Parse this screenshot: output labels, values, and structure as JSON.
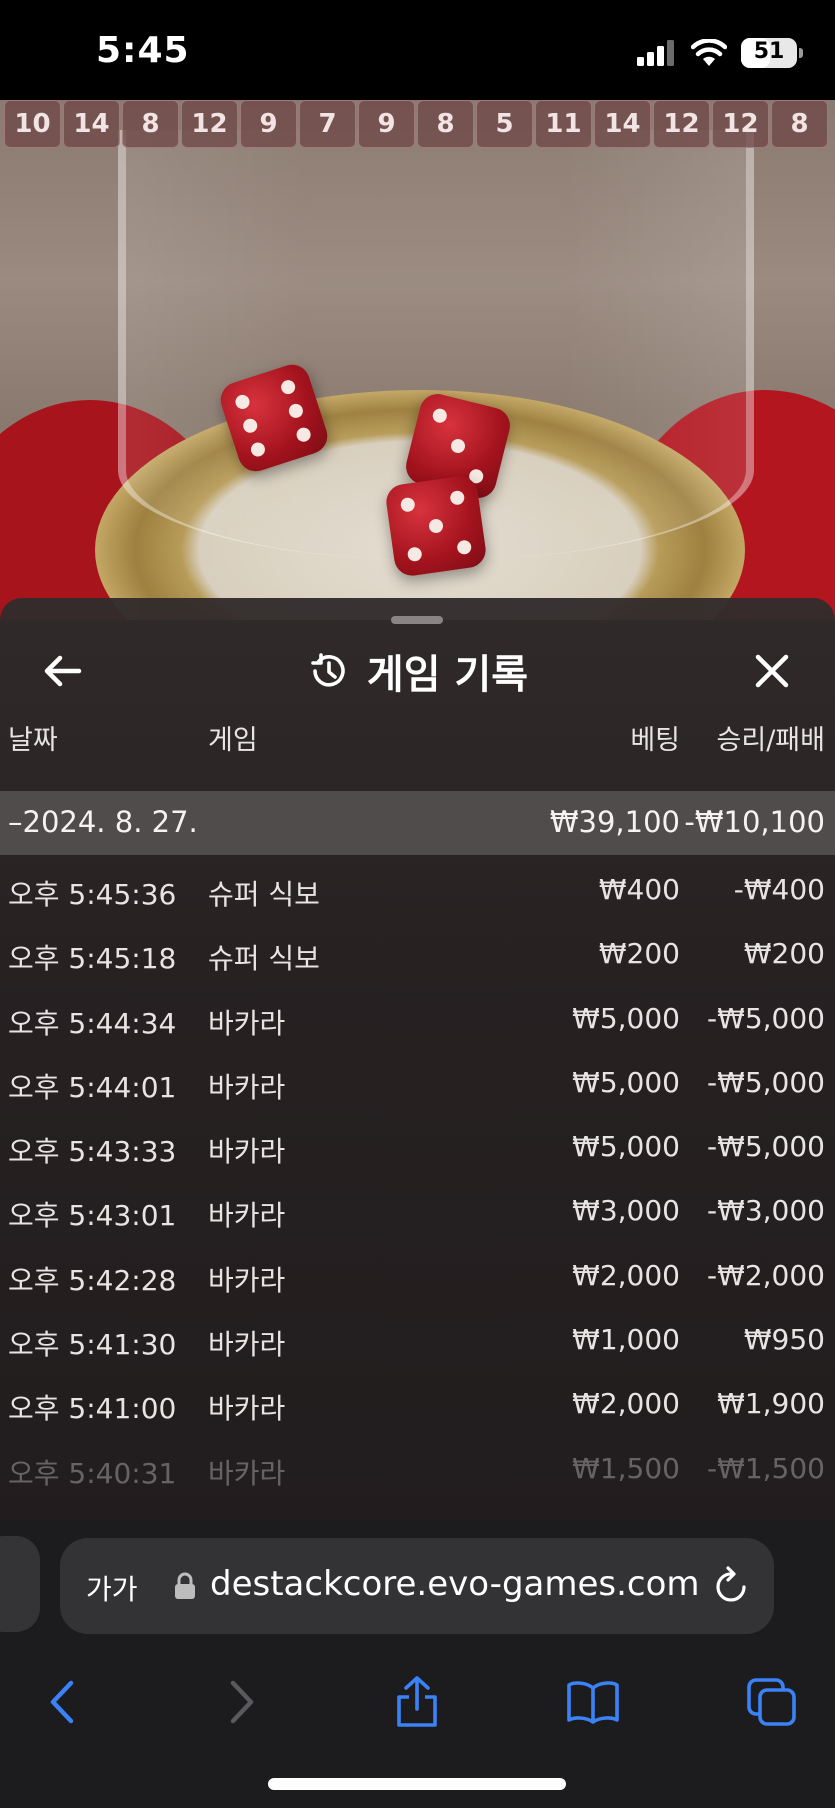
{
  "status_bar": {
    "time": "5:45",
    "battery": "51",
    "battery_level": 0.51,
    "icons": [
      "signal-icon",
      "wifi-icon",
      "battery-icon"
    ]
  },
  "game": {
    "history": [
      "10",
      "14",
      "8",
      "12",
      "9",
      "7",
      "9",
      "8",
      "5",
      "11",
      "14",
      "12",
      "12",
      "8"
    ]
  },
  "sheet": {
    "title": "게임 기록",
    "icons": {
      "back": "arrow-left-icon",
      "history": "history-icon",
      "close": "close-icon"
    }
  },
  "table": {
    "headers": {
      "date": "날짜",
      "game": "게임",
      "bet": "베팅",
      "result": "승리/패배"
    },
    "day": {
      "date": "–2024. 8. 27.",
      "bet": "₩39,100",
      "result": "-₩10,100"
    },
    "rows": [
      {
        "time": "오후 5:45:36",
        "game": "슈퍼 식보",
        "bet": "₩400",
        "result": "-₩400"
      },
      {
        "time": "오후 5:45:18",
        "game": "슈퍼 식보",
        "bet": "₩200",
        "result": "₩200"
      },
      {
        "time": "오후 5:44:34",
        "game": "바카라",
        "bet": "₩5,000",
        "result": "-₩5,000"
      },
      {
        "time": "오후 5:44:01",
        "game": "바카라",
        "bet": "₩5,000",
        "result": "-₩5,000"
      },
      {
        "time": "오후 5:43:33",
        "game": "바카라",
        "bet": "₩5,000",
        "result": "-₩5,000"
      },
      {
        "time": "오후 5:43:01",
        "game": "바카라",
        "bet": "₩3,000",
        "result": "-₩3,000"
      },
      {
        "time": "오후 5:42:28",
        "game": "바카라",
        "bet": "₩2,000",
        "result": "-₩2,000"
      },
      {
        "time": "오후 5:41:30",
        "game": "바카라",
        "bet": "₩1,000",
        "result": "₩950"
      },
      {
        "time": "오후 5:41:00",
        "game": "바카라",
        "bet": "₩2,000",
        "result": "₩1,900"
      },
      {
        "time": "오후 5:40:31",
        "game": "바카라",
        "bet": "₩1,500",
        "result": "-₩1,500"
      }
    ]
  },
  "browser": {
    "aa_label": "가가",
    "url": "destackcore.evo-games.com",
    "accent": "#3b82f6"
  }
}
